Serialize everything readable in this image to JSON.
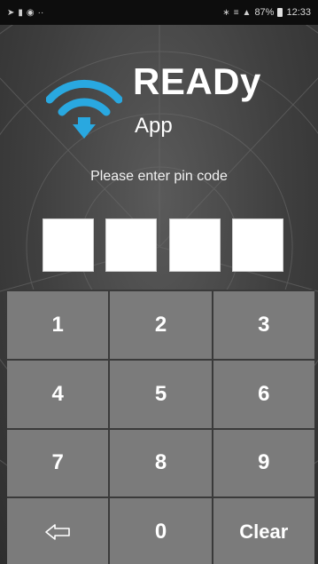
{
  "status_bar": {
    "left_icons": [
      "location-icon",
      "message-icon",
      "tools-icon",
      "more-icon"
    ],
    "right_icons": [
      "bluetooth-icon",
      "vibrate-icon",
      "signal-icon"
    ],
    "battery": "87%",
    "time": "12:33"
  },
  "app": {
    "title": "READy",
    "subtitle": "App",
    "logo_icon": "wifi-download-icon",
    "accent_color": "#29a8e0"
  },
  "pin": {
    "prompt": "Please enter pin code",
    "digits": [
      "",
      "",
      "",
      ""
    ]
  },
  "keypad": {
    "keys": [
      {
        "label": "1",
        "name": "key-1"
      },
      {
        "label": "2",
        "name": "key-2"
      },
      {
        "label": "3",
        "name": "key-3"
      },
      {
        "label": "4",
        "name": "key-4"
      },
      {
        "label": "5",
        "name": "key-5"
      },
      {
        "label": "6",
        "name": "key-6"
      },
      {
        "label": "7",
        "name": "key-7"
      },
      {
        "label": "8",
        "name": "key-8"
      },
      {
        "label": "9",
        "name": "key-9"
      },
      {
        "label": "",
        "name": "backspace-key",
        "icon": "backspace-arrow-icon"
      },
      {
        "label": "0",
        "name": "key-0"
      },
      {
        "label": "Clear",
        "name": "clear-key"
      }
    ]
  }
}
